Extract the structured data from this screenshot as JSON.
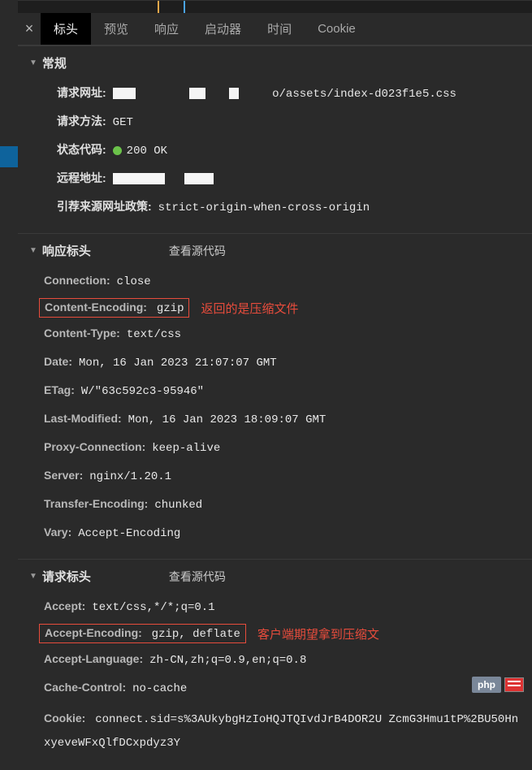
{
  "tabs": {
    "header": "标头",
    "preview": "预览",
    "response": "响应",
    "initiator": "启动器",
    "timing": "时间",
    "cookie": "Cookie"
  },
  "annotations": {
    "response_compressed": "返回的是压缩文件",
    "client_expects_compressed": "客户端期望拿到压缩文"
  },
  "sections": {
    "general": {
      "title": "常规",
      "url_label": "请求网址:",
      "url_suffix": "o/assets/index-d023f1e5.css",
      "method_label": "请求方法:",
      "method_value": "GET",
      "status_label": "状态代码:",
      "status_value": "200 OK",
      "remote_label": "远程地址:",
      "referrer_label": "引荐来源网址政策:",
      "referrer_value": "strict-origin-when-cross-origin"
    },
    "response_headers": {
      "title": "响应标头",
      "view_source": "查看源代码",
      "items": {
        "connection_key": "Connection:",
        "connection_val": "close",
        "content_encoding_key": "Content-Encoding:",
        "content_encoding_val": "gzip",
        "content_type_key": "Content-Type:",
        "content_type_val": "text/css",
        "date_key": "Date:",
        "date_val": "Mon, 16 Jan 2023 21:07:07 GMT",
        "etag_key": "ETag:",
        "etag_val": "W/\"63c592c3-95946\"",
        "last_modified_key": "Last-Modified:",
        "last_modified_val": "Mon, 16 Jan 2023 18:09:07 GMT",
        "proxy_connection_key": "Proxy-Connection:",
        "proxy_connection_val": "keep-alive",
        "server_key": "Server:",
        "server_val": "nginx/1.20.1",
        "transfer_encoding_key": "Transfer-Encoding:",
        "transfer_encoding_val": "chunked",
        "vary_key": "Vary:",
        "vary_val": "Accept-Encoding"
      }
    },
    "request_headers": {
      "title": "请求标头",
      "view_source": "查看源代码",
      "items": {
        "accept_key": "Accept:",
        "accept_val": "text/css,*/*;q=0.1",
        "accept_encoding_key": "Accept-Encoding:",
        "accept_encoding_val": "gzip, deflate",
        "accept_language_key": "Accept-Language:",
        "accept_language_val": "zh-CN,zh;q=0.9,en;q=0.8",
        "cache_control_key": "Cache-Control:",
        "cache_control_val": "no-cache",
        "cookie_key": "Cookie:",
        "cookie_val": "connect.sid=s%3AUkybgHzIoHQJTQIvdJrB4DOR2U ZcmG3Hmu1tP%2BU50HnxyeveWFxQlfDCxpdyz3Y"
      }
    }
  },
  "badge": {
    "php": "php"
  }
}
